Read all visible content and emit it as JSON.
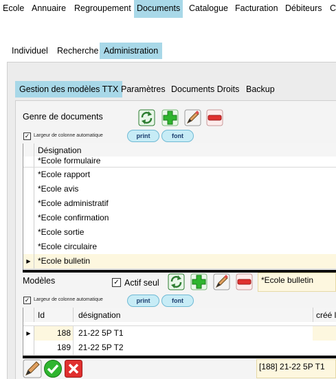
{
  "menu": [
    "Ecole",
    "Annuaire",
    "Regroupement",
    "Documents",
    "Catalogue",
    "Facturation",
    "Débiteurs",
    "C"
  ],
  "menu_active": "Documents",
  "subtabs": [
    "Individuel",
    "Recherche",
    "Administration"
  ],
  "subtabs_active": "Administration",
  "innertabs": [
    "Gestion des modèles TTX",
    "Paramètres",
    "Documents Droits",
    "Backup"
  ],
  "innertabs_active": "Gestion des modèles TTX",
  "genre": {
    "label": "Genre de documents",
    "auto_width_label": "Largeur de colonne automatique",
    "print": "print",
    "font": "font",
    "column": "Désignation",
    "rows": [
      "*Ecole formulaire",
      "*Ecole rapport",
      "*Ecole avis",
      "*Ecole administratif",
      "*Ecole confirmation",
      "*Ecole sortie",
      "*Ecole circulaire",
      "*Ecole bulletin"
    ],
    "selected": "*Ecole bulletin"
  },
  "modeles": {
    "label": "Modèles",
    "actif_label": "Actif seul",
    "selected_genre": "*Ecole bulletin",
    "auto_width_label": "Largeur de colonne automatique",
    "print": "print",
    "font": "font",
    "columns": [
      "Id",
      "désignation",
      "créé l"
    ],
    "rows": [
      {
        "id": "188",
        "designation": "21-22 5P T1"
      },
      {
        "id": "189",
        "designation": "21-22 5P T2"
      }
    ],
    "status": "[188] 21-22 5P T1"
  },
  "colors": {
    "accent": "#a8d8e8",
    "selection": "#fdf7df",
    "add": "#2fb52f",
    "delete": "#e0302f"
  },
  "icons": [
    "refresh-icon",
    "add-icon",
    "edit-icon",
    "remove-icon",
    "confirm-icon",
    "cancel-icon"
  ]
}
